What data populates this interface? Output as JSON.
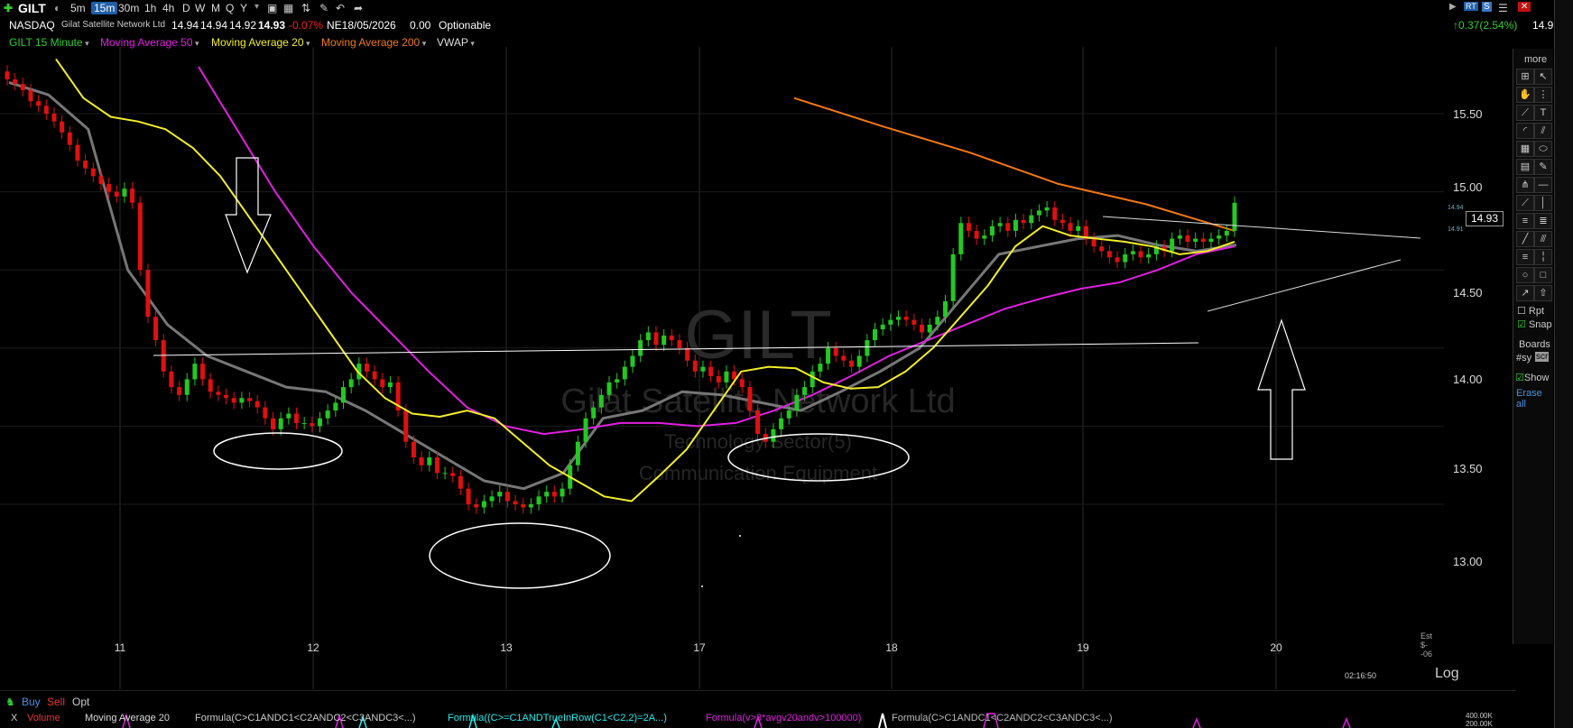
{
  "toolbar": {
    "symbol": "GILT",
    "timeframes": [
      "5m",
      "15m",
      "30m",
      "1h",
      "4h",
      "D",
      "W",
      "M",
      "Q",
      "Y"
    ],
    "active_timeframe": "15m",
    "change_text": "0.37(2.54%)",
    "last_price": "14.93"
  },
  "quote": {
    "exchange": "NASDAQ",
    "company": "Gilat Satellite Network Ltd",
    "open": "14.94",
    "high": "14.94",
    "low": "14.92",
    "close": "14.93",
    "change_pct": "-0.07%",
    "earnings": "NE18/05/2026",
    "dividend": "0.00",
    "options": "Optionable"
  },
  "studies": {
    "main": "GILT 15 Minute",
    "ma50": "Moving Average 50",
    "ma20": "Moving Average 20",
    "ma200": "Moving Average 200",
    "vwap": "VWAP"
  },
  "colors": {
    "up": "#22c922",
    "down": "#e01010",
    "ma20": "#f2ee2a",
    "ma50": "#e020e0",
    "ma200": "#f07818",
    "vwap": "#777777",
    "annotation": "#ffffff"
  },
  "watermark": {
    "symbol": "GILT",
    "company": "Gilat Satellite Network Ltd",
    "sector": "Technology Sector(5)",
    "industry": "Communication Equipment"
  },
  "price_axis": {
    "ticks": [
      "15.50",
      "15.00",
      "14.50",
      "14.00",
      "13.50",
      "13.00"
    ],
    "last_price_label": "14.93",
    "small_high": "14.94",
    "small_low": "14.91"
  },
  "chart_data": {
    "type": "candlestick",
    "x_tick_labels": [
      "11",
      "12",
      "13",
      "17",
      "18",
      "19",
      "20"
    ],
    "ylim": [
      12.55,
      15.95
    ],
    "price_ticks": [
      15.5,
      15.0,
      14.5,
      14.0,
      13.5,
      13.0
    ],
    "closes": [
      15.72,
      15.69,
      15.65,
      15.58,
      15.55,
      15.5,
      15.45,
      15.38,
      15.3,
      15.2,
      15.15,
      15.1,
      15.05,
      15.0,
      14.97,
      15.02,
      14.93,
      14.5,
      14.2,
      14.05,
      13.85,
      13.75,
      13.7,
      13.8,
      13.9,
      13.8,
      13.72,
      13.7,
      13.68,
      13.65,
      13.68,
      13.66,
      13.62,
      13.55,
      13.48,
      13.55,
      13.58,
      13.52,
      13.52,
      13.5,
      13.55,
      13.6,
      13.65,
      13.75,
      13.8,
      13.9,
      13.85,
      13.8,
      13.75,
      13.78,
      13.6,
      13.4,
      13.3,
      13.25,
      13.3,
      13.2,
      13.2,
      13.18,
      13.1,
      13.0,
      12.98,
      13.02,
      13.05,
      13.08,
      13.02,
      13.0,
      12.98,
      13.0,
      13.05,
      13.08,
      13.05,
      13.1,
      13.25,
      13.4,
      13.55,
      13.62,
      13.7,
      13.78,
      13.8,
      13.88,
      13.95,
      14.05,
      14.1,
      14.02,
      14.08,
      14.05,
      14.0,
      13.92,
      13.85,
      13.88,
      13.82,
      13.78,
      13.85,
      13.8,
      13.75,
      13.6,
      13.45,
      13.4,
      13.48,
      13.55,
      13.6,
      13.7,
      13.75,
      13.85,
      13.9,
      14.0,
      13.95,
      13.92,
      13.88,
      13.95,
      14.05,
      14.12,
      14.15,
      14.18,
      14.2,
      14.18,
      14.15,
      14.1,
      14.15,
      14.2,
      14.3,
      14.6,
      14.8,
      14.75,
      14.7,
      14.72,
      14.78,
      14.8,
      14.75,
      14.82,
      14.8,
      14.85,
      14.88,
      14.9,
      14.82,
      14.8,
      14.75,
      14.78,
      14.7,
      14.65,
      14.62,
      14.58,
      14.55,
      14.6,
      14.62,
      14.58,
      14.6,
      14.65,
      14.62,
      14.7,
      14.72,
      14.68,
      14.7,
      14.68,
      14.7,
      14.72,
      14.75,
      14.93
    ],
    "ma20": [
      15.85,
      15.6,
      15.48,
      15.45,
      15.4,
      15.28,
      15.1,
      14.85,
      14.6,
      14.35,
      14.1,
      13.85,
      13.68,
      13.58,
      13.56,
      13.6,
      13.55,
      13.4,
      13.25,
      13.15,
      13.05,
      13.02,
      13.18,
      13.35,
      13.6,
      13.85,
      13.88,
      13.87,
      13.78,
      13.74,
      13.75,
      13.85,
      14.0,
      14.2,
      14.4,
      14.65,
      14.78,
      14.72,
      14.7,
      14.68,
      14.65,
      14.6,
      14.62,
      14.68
    ],
    "ma50": [
      15.8,
      15.4,
      15.0,
      14.65,
      14.35,
      14.1,
      13.85,
      13.62,
      13.5,
      13.45,
      13.48,
      13.52,
      13.52,
      13.5,
      13.52,
      13.6,
      13.7,
      13.82,
      13.95,
      14.05,
      14.15,
      14.25,
      14.32,
      14.38,
      14.42,
      14.5,
      14.6,
      14.65
    ],
    "ma200": [
      15.6,
      15.42,
      15.25,
      15.05,
      14.92,
      14.75
    ],
    "vwap": [
      15.7,
      15.62,
      15.4,
      14.5,
      14.15,
      13.95,
      13.85,
      13.75,
      13.72,
      13.6,
      13.45,
      13.3,
      13.15,
      13.1,
      13.2,
      13.55,
      13.6,
      13.72,
      13.7,
      13.65,
      13.6,
      13.72,
      13.85,
      14.0,
      14.3,
      14.6,
      14.65,
      14.7,
      14.72,
      14.66,
      14.62,
      14.66
    ]
  },
  "right_panel": {
    "more": "more",
    "rpt": "Rpt",
    "snap": "Snap",
    "boards": "Boards",
    "sy": "#sy",
    "scr": "scr",
    "show": "Show",
    "erase_all": "Erase all"
  },
  "bottom": {
    "close_x": "X",
    "buy": "Buy",
    "sell": "Sell",
    "opt": "Opt",
    "log": "Log",
    "time": "02:16:50",
    "est": "Est $--06",
    "indicators": [
      "Volume",
      "Moving Average 20",
      "Formula(C>C1ANDC1<C2ANDC2<C3ANDC3<...)",
      "Formula((C>=C1ANDTrueInRow(C1<C2,2)=2A...)",
      "Formula(v>3*avgv20andv>100000)",
      "Formula(C>C1ANDC1<C2ANDC2<C3ANDC3<...)"
    ],
    "vol_max": "400.00K",
    "vol_mid": "200.00K"
  },
  "top_right": {
    "rt": "RT",
    "s": "S"
  }
}
